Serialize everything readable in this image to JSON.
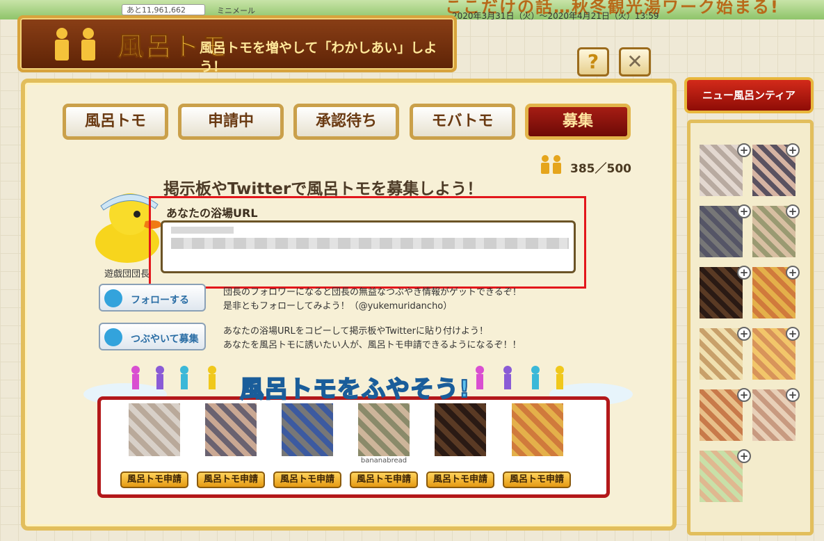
{
  "topbar": {
    "level_text": "あと11,961,662",
    "mini_mail": "ミニメール",
    "event_title": "ここだけの話…秋冬観光湯ワーク始まる!",
    "event_period": "2020年3月31日（火）～2020年4月21日（火）13:59"
  },
  "header": {
    "title": "風呂トモ",
    "subtitle": "風呂トモを増やして「わかしあい」しよう！",
    "help_label": "?",
    "close_label": "✕"
  },
  "tabs": [
    {
      "label": "風呂トモ",
      "active": false
    },
    {
      "label": "申請中",
      "active": false
    },
    {
      "label": "承認待ち",
      "active": false
    },
    {
      "label": "モバトモ",
      "active": false
    },
    {
      "label": "募集",
      "active": true
    }
  ],
  "counter": "385／500",
  "headline": "掲示板やTwitterで風呂トモを募集しよう！",
  "mascot_name": "遊戯団団長",
  "url_section": {
    "label": "あなたの浴場URL"
  },
  "follow": {
    "button_label": "フォローする",
    "line1": "団長のフォロワーになると団長の無益なつぶやき情報がゲットできるぞ！",
    "line2": "是非ともフォローしてみよう！（@yukemuridancho）"
  },
  "tweet": {
    "button_label": "つぶやいて募集",
    "line1": "あなたの浴場URLをコピーして掲示板やTwitterに貼り付けよう！",
    "line2": "あなたを風呂トモに誘いたい人が、風呂トモ申請できるようになるぞ！！"
  },
  "recruit": {
    "title": "風呂トモをふやそう!",
    "candidates": [
      {
        "name": "",
        "request_label": "風呂トモ申請"
      },
      {
        "name": "",
        "request_label": "風呂トモ申請"
      },
      {
        "name": "",
        "request_label": "風呂トモ申請"
      },
      {
        "name": "bananabread",
        "request_label": "風呂トモ申請"
      },
      {
        "name": "",
        "request_label": "風呂トモ申請"
      },
      {
        "name": "",
        "request_label": "風呂トモ申請"
      }
    ]
  },
  "sidebar": {
    "new_button": "ニュー風呂ンティア"
  },
  "colors": {
    "accent_red": "#a61d14",
    "gold": "#e2be5c",
    "highlight": "#e3161b"
  }
}
